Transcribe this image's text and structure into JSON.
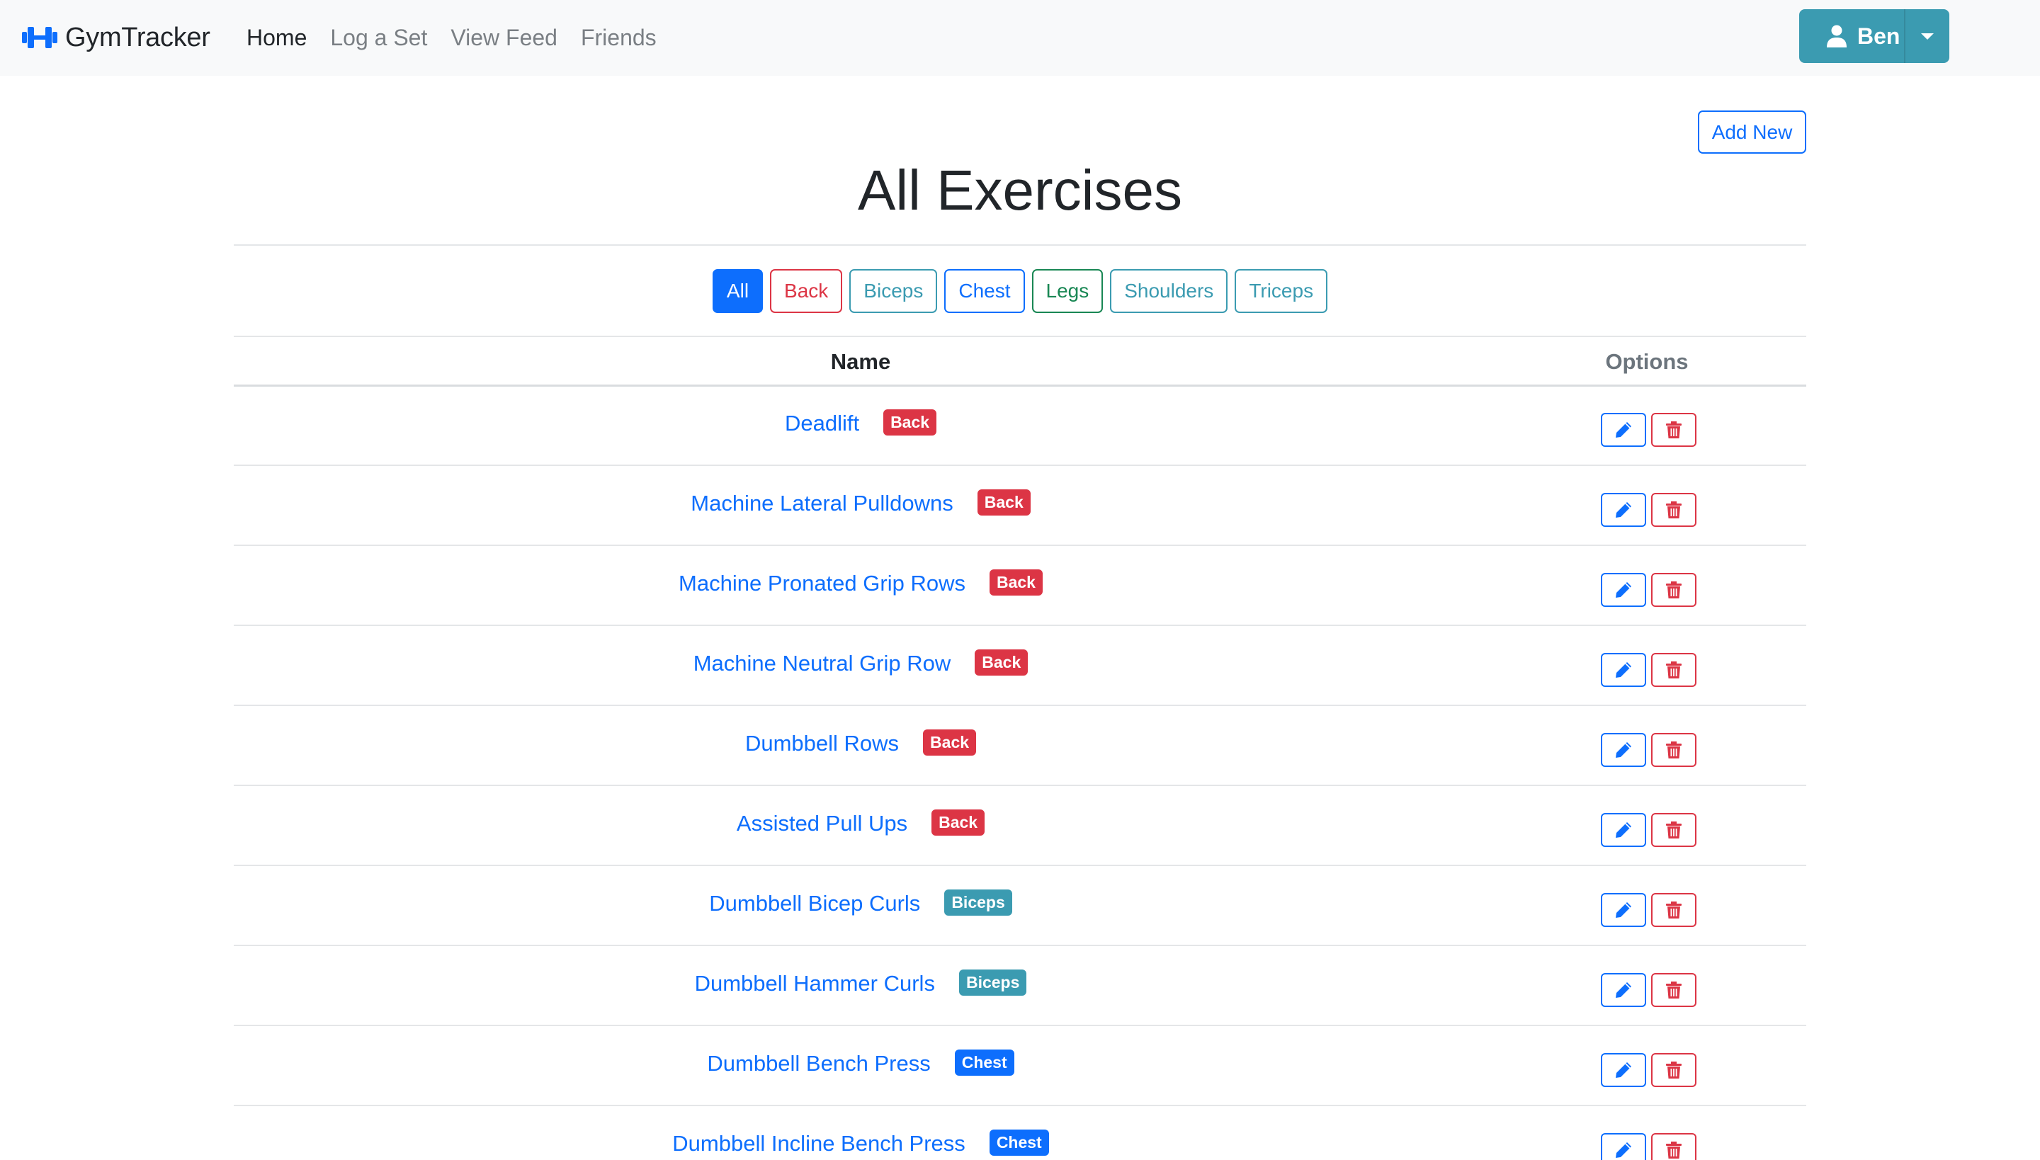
{
  "brand": {
    "name": "GymTracker",
    "icon": "dumbbell-icon",
    "color": "#0d6efd"
  },
  "nav": {
    "items": [
      {
        "label": "Home",
        "active": true
      },
      {
        "label": "Log a Set",
        "active": false
      },
      {
        "label": "View Feed",
        "active": false
      },
      {
        "label": "Friends",
        "active": false
      }
    ]
  },
  "user_menu": {
    "name": "Ben",
    "icon": "user-icon",
    "caret_icon": "caret-down-icon",
    "color": "#3b9bb1"
  },
  "page": {
    "title": "All Exercises",
    "add_new_label": "Add New"
  },
  "filters": [
    {
      "label": "All",
      "active": true
    },
    {
      "label": "Back",
      "active": false,
      "color": "#dc3545"
    },
    {
      "label": "Biceps",
      "active": false,
      "color": "#3b9bb1"
    },
    {
      "label": "Chest",
      "active": false,
      "color": "#0d6efd"
    },
    {
      "label": "Legs",
      "active": false,
      "color": "#198754"
    },
    {
      "label": "Shoulders",
      "active": false,
      "color": "#3b9bb1"
    },
    {
      "label": "Triceps",
      "active": false,
      "color": "#3b9bb1"
    }
  ],
  "table": {
    "headers": {
      "name": "Name",
      "options": "Options"
    },
    "rows": [
      {
        "name": "Deadlift",
        "category": "Back"
      },
      {
        "name": "Machine Lateral Pulldowns",
        "category": "Back"
      },
      {
        "name": "Machine Pronated Grip Rows",
        "category": "Back"
      },
      {
        "name": "Machine Neutral Grip Row",
        "category": "Back"
      },
      {
        "name": "Dumbbell Rows",
        "category": "Back"
      },
      {
        "name": "Assisted Pull Ups",
        "category": "Back"
      },
      {
        "name": "Dumbbell Bicep Curls",
        "category": "Biceps"
      },
      {
        "name": "Dumbbell Hammer Curls",
        "category": "Biceps"
      },
      {
        "name": "Dumbbell Bench Press",
        "category": "Chest"
      },
      {
        "name": "Dumbbell Incline Bench Press",
        "category": "Chest"
      }
    ],
    "row_actions": {
      "edit_icon": "pencil-icon",
      "delete_icon": "trash-icon"
    }
  },
  "category_colors": {
    "Back": "#dc3545",
    "Biceps": "#3b9bb1",
    "Chest": "#0d6efd"
  }
}
